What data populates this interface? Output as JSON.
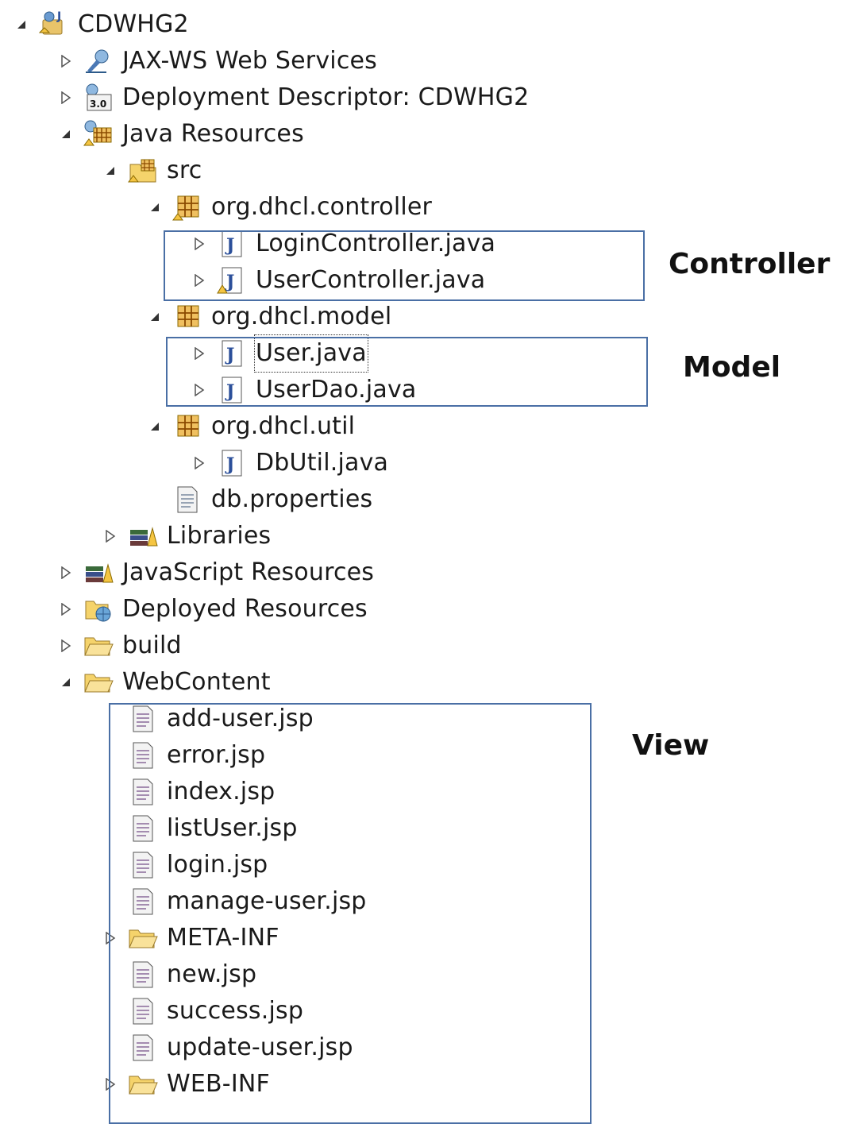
{
  "project_explorer": {
    "root": {
      "label": "CDWHG2",
      "icon": "dynamic-web-project-icon",
      "expanded": true
    },
    "nodes": [
      {
        "label": "JAX-WS Web Services",
        "icon": "web-services-icon",
        "expanded": false
      },
      {
        "label": "Deployment Descriptor: CDWHG2",
        "icon": "deployment-descriptor-icon",
        "badge": "3.0",
        "expanded": false
      },
      {
        "label": "Java Resources",
        "icon": "java-resources-icon",
        "expanded": true
      },
      {
        "label": "src",
        "icon": "source-folder-icon",
        "expanded": true
      },
      {
        "label": "org.dhcl.controller",
        "icon": "package-icon",
        "expanded": true
      },
      {
        "label": "LoginController.java",
        "icon": "java-file-icon",
        "expanded": false
      },
      {
        "label": "UserController.java",
        "icon": "java-file-warning-icon",
        "expanded": false
      },
      {
        "label": "org.dhcl.model",
        "icon": "package-icon",
        "expanded": true
      },
      {
        "label": "User.java",
        "icon": "java-file-icon",
        "expanded": false
      },
      {
        "label": "UserDao.java",
        "icon": "java-file-icon",
        "expanded": false
      },
      {
        "label": "org.dhcl.util",
        "icon": "package-icon",
        "expanded": true
      },
      {
        "label": "DbUtil.java",
        "icon": "java-file-icon",
        "expanded": false
      },
      {
        "label": "db.properties",
        "icon": "properties-file-icon"
      },
      {
        "label": "Libraries",
        "icon": "libraries-icon",
        "expanded": false
      },
      {
        "label": "JavaScript Resources",
        "icon": "libraries-icon",
        "expanded": false
      },
      {
        "label": "Deployed Resources",
        "icon": "deployed-resources-icon",
        "expanded": false
      },
      {
        "label": "build",
        "icon": "folder-icon",
        "expanded": false
      },
      {
        "label": "WebContent",
        "icon": "folder-icon",
        "expanded": true
      },
      {
        "label": "add-user.jsp",
        "icon": "jsp-file-icon"
      },
      {
        "label": "error.jsp",
        "icon": "jsp-file-icon"
      },
      {
        "label": "index.jsp",
        "icon": "jsp-file-icon"
      },
      {
        "label": "listUser.jsp",
        "icon": "jsp-file-icon"
      },
      {
        "label": "login.jsp",
        "icon": "jsp-file-icon"
      },
      {
        "label": "manage-user.jsp",
        "icon": "jsp-file-icon"
      },
      {
        "label": "META-INF",
        "icon": "folder-icon",
        "expanded": false
      },
      {
        "label": "new.jsp",
        "icon": "jsp-file-icon"
      },
      {
        "label": "success.jsp",
        "icon": "jsp-file-icon"
      },
      {
        "label": "update-user.jsp",
        "icon": "jsp-file-icon"
      },
      {
        "label": "WEB-INF",
        "icon": "folder-icon",
        "expanded": false
      }
    ]
  },
  "annotations": {
    "controller": "Controller",
    "model": "Model",
    "view": "View"
  },
  "colors": {
    "annotation_border": "#4a6fa5",
    "folder": "#f5d36b",
    "java_badge": "#2b4f9a"
  }
}
